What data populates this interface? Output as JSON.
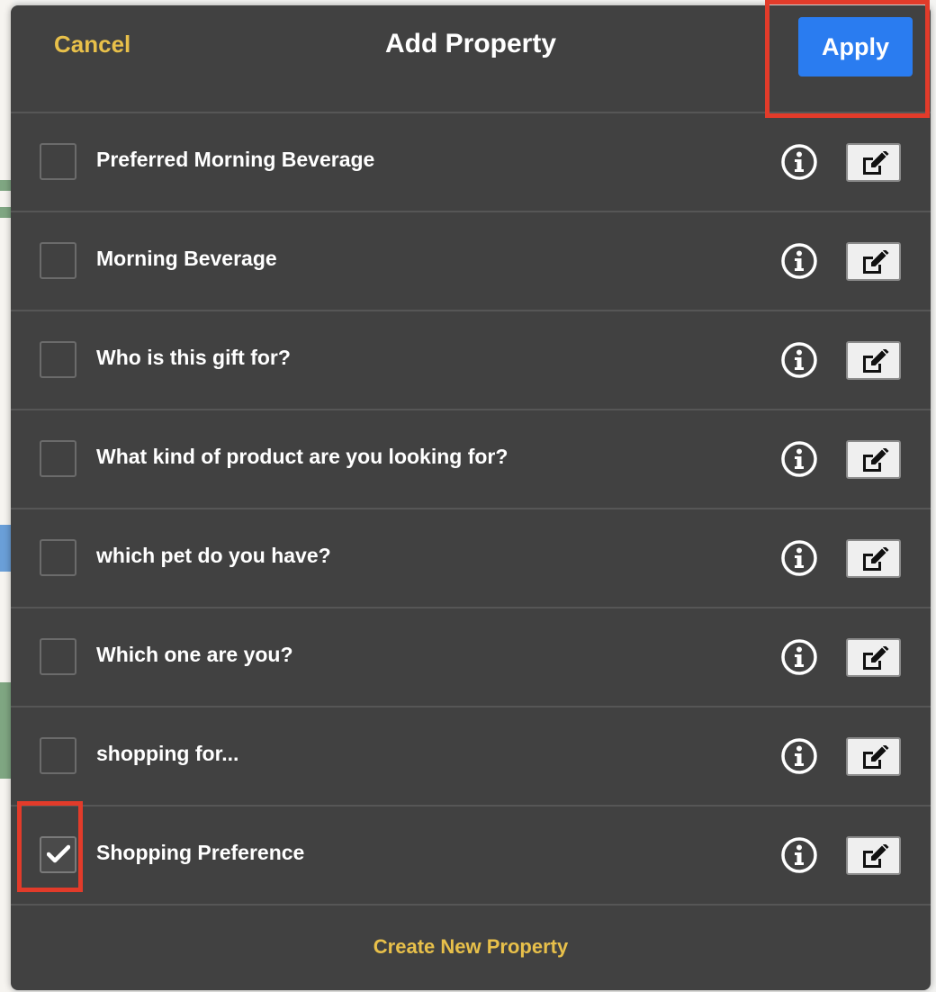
{
  "header": {
    "cancel_label": "Cancel",
    "title": "Add Property",
    "apply_label": "Apply"
  },
  "properties": [
    {
      "label": "Preferred Morning Beverage",
      "checked": false
    },
    {
      "label": "Morning Beverage",
      "checked": false
    },
    {
      "label": "Who is this gift for?",
      "checked": false
    },
    {
      "label": "What kind of product are you looking for?",
      "checked": false
    },
    {
      "label": "which pet do you have?",
      "checked": false
    },
    {
      "label": "Which one are you?",
      "checked": false
    },
    {
      "label": "shopping for...",
      "checked": false
    },
    {
      "label": "Shopping Preference",
      "checked": true
    }
  ],
  "footer": {
    "create_label": "Create New Property"
  },
  "icons": {
    "row_info": "info-circle-icon",
    "row_edit": "edit-icon",
    "check": "checkmark-icon"
  },
  "colors": {
    "modal_bg": "#414141",
    "accent_yellow": "#e8c04a",
    "apply_blue": "#2a7cf0",
    "highlight_red": "#e23b2a"
  }
}
